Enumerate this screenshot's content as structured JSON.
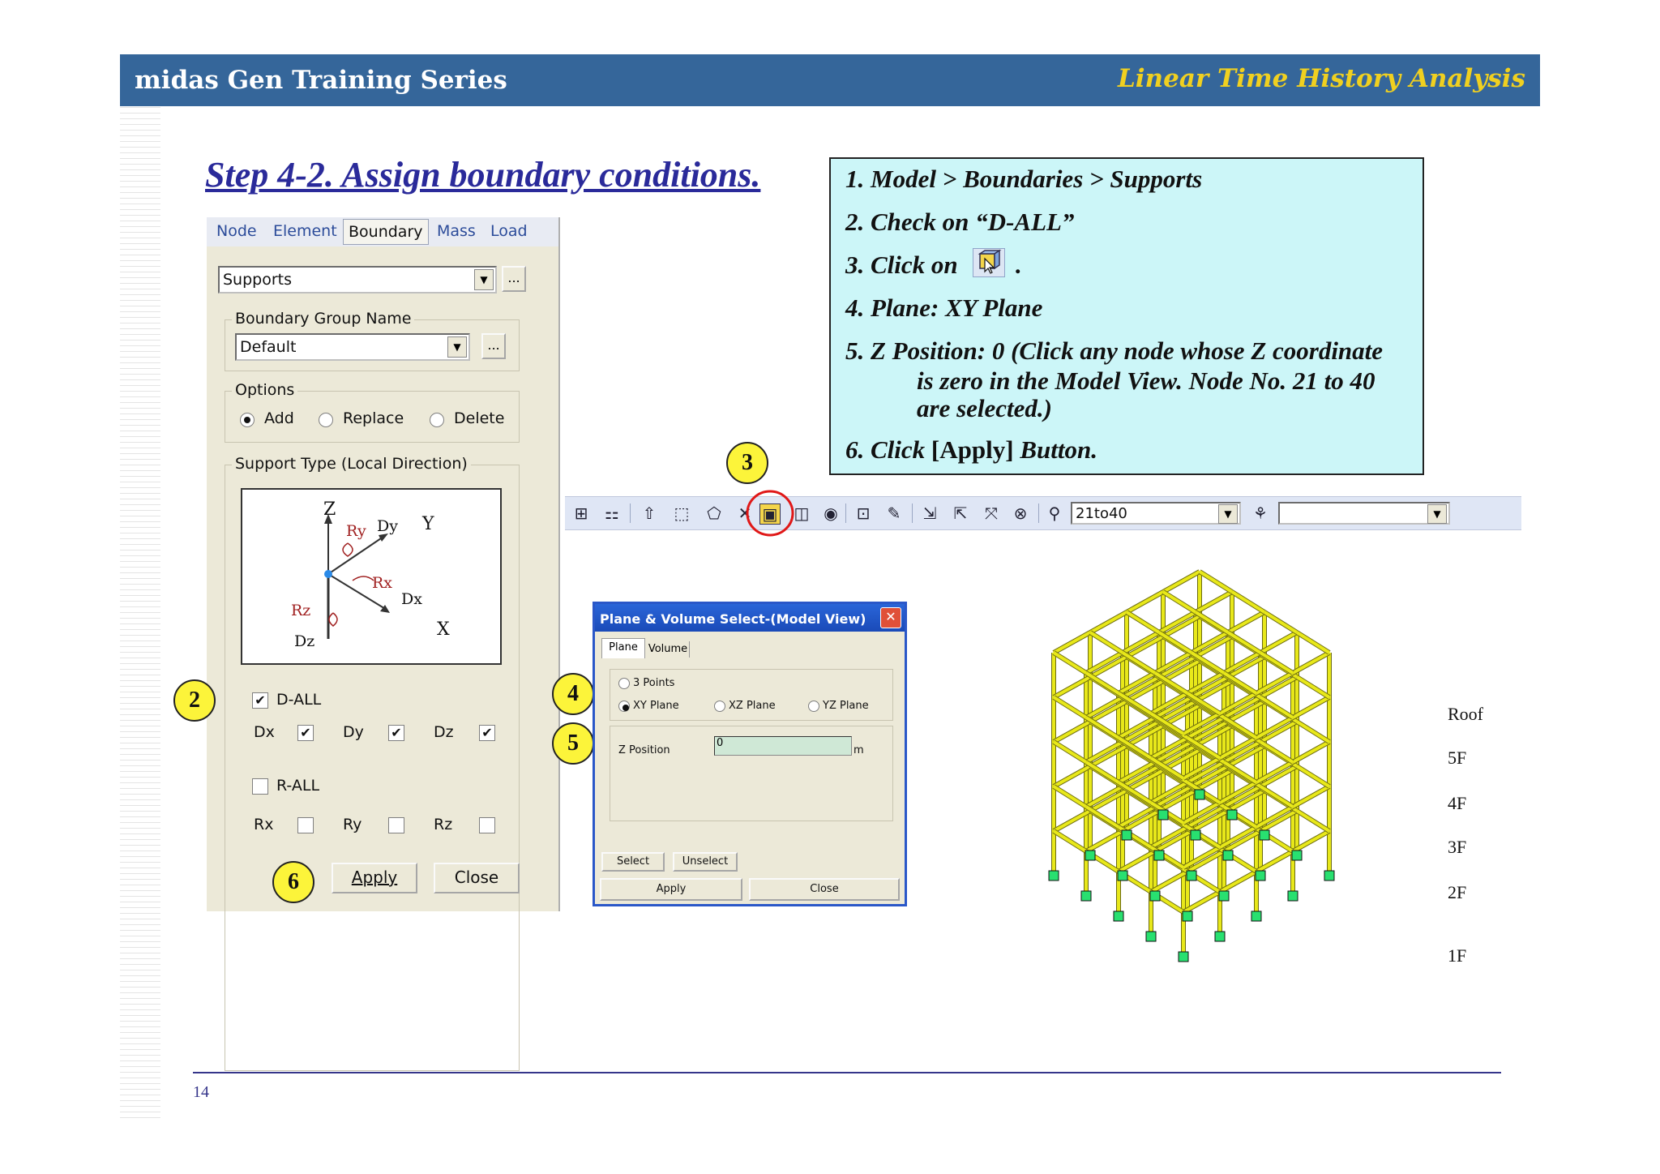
{
  "header": {
    "left_title": "midas Gen Training Series",
    "right_title": "Linear Time History Analysis"
  },
  "step_title": "Step 4-2. Assign boundary conditions.",
  "instructions": {
    "line1": "1. Model > Boundaries > Supports",
    "line2": "2. Check on “D-ALL”",
    "line3_prefix": "3. Click on",
    "line3_suffix": ".",
    "line4": "4. Plane: XY Plane",
    "line5a": "5. Z Position: 0 (Click any node whose Z coordinate",
    "line5b": "is zero in the Model View. Node No. 21 to 40",
    "line5c": "are selected.)",
    "line6_prefix": "6. Click",
    "line6_button": "[Apply]",
    "line6_suffix": "Button."
  },
  "panel": {
    "tabs": [
      "Node",
      "Element",
      "Boundary",
      "Mass",
      "Load"
    ],
    "active_tab": "Boundary",
    "function_select": "Supports",
    "dots": "...",
    "group_name_label": "Boundary Group Name",
    "group_name_value": "Default",
    "options_label": "Options",
    "options": [
      "Add",
      "Replace",
      "Delete"
    ],
    "selected_option": "Add",
    "support_type_label": "Support Type (Local Direction)",
    "diagram_labels": {
      "z": "Z",
      "y": "Y",
      "x": "X",
      "ry": "Ry",
      "dy": "Dy",
      "rx": "Rx",
      "dx": "Dx",
      "rz": "Rz",
      "dz": "Dz"
    },
    "d_all": "D-ALL",
    "d_items": [
      "Dx",
      "Dy",
      "Dz"
    ],
    "r_all": "R-ALL",
    "r_items": [
      "Rx",
      "Ry",
      "Rz"
    ],
    "apply": "Apply",
    "close": "Close"
  },
  "markers": [
    "2",
    "3",
    "4",
    "5",
    "6"
  ],
  "toolbar": {
    "selection_value": "21to40"
  },
  "dialog": {
    "title": "Plane & Volume Select-(Model View)",
    "close_glyph": "✕",
    "tabs": [
      "Plane",
      "Volume"
    ],
    "plane_options": [
      "3 Points",
      "XY Plane",
      "XZ Plane",
      "YZ Plane"
    ],
    "selected_plane": "XY Plane",
    "z_position_label": "Z Position",
    "z_position_value": "0",
    "unit": "m",
    "select": "Select",
    "unselect": "Unselect",
    "apply": "Apply",
    "close": "Close"
  },
  "model_view": {
    "floor_labels": [
      "Roof",
      "5F",
      "4F",
      "3F",
      "2F",
      "1F"
    ]
  },
  "footer": {
    "page_number": "14"
  }
}
